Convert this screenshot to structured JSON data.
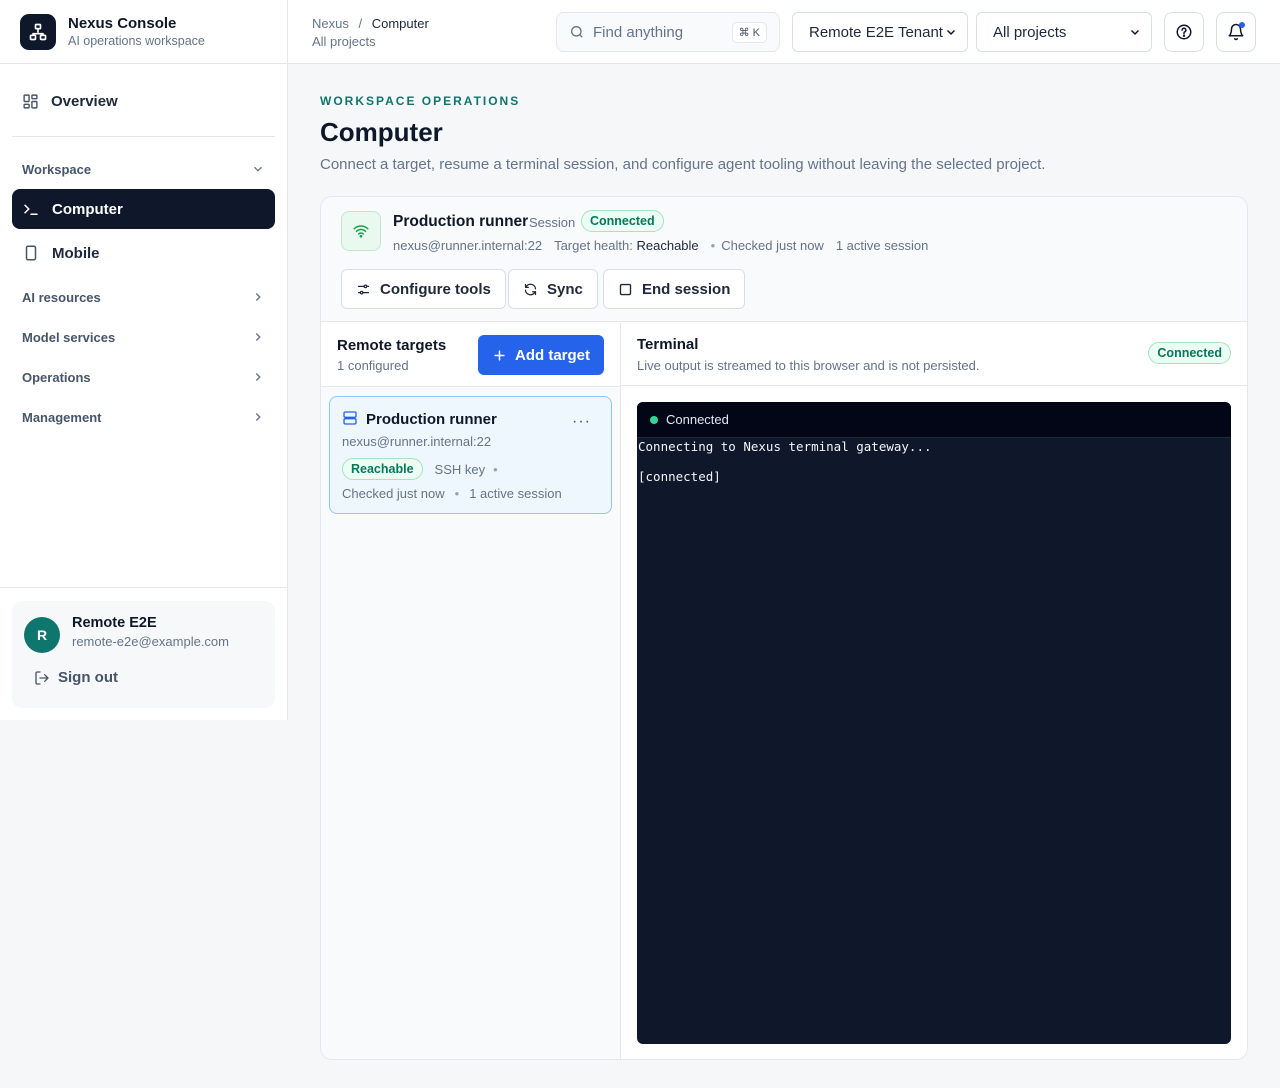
{
  "brand": {
    "title": "Nexus Console",
    "subtitle": "AI operations workspace"
  },
  "sidebar": {
    "overview": "Overview",
    "groups": {
      "workspace": "Workspace",
      "ai_resources": "AI resources",
      "model_services": "Model services",
      "operations": "Operations",
      "management": "Management"
    },
    "items": {
      "computer": "Computer",
      "mobile": "Mobile"
    }
  },
  "user": {
    "initial": "R",
    "name": "Remote E2E",
    "email": "remote-e2e@example.com",
    "signout": "Sign out"
  },
  "topbar": {
    "breadcrumb_root": "Nexus",
    "breadcrumb_sep": "/",
    "breadcrumb_current": "Computer",
    "breadcrumb_sub": "All projects",
    "search_placeholder": "Find anything",
    "search_shortcut": "⌘ K",
    "tenant": "Remote E2E Tenant",
    "project": "All projects"
  },
  "header": {
    "eyebrow": "WORKSPACE OPERATIONS",
    "title": "Computer",
    "description": "Connect a target, resume a terminal session, and configure agent tooling without leaving the selected project."
  },
  "session": {
    "name": "Production runner",
    "label": "Session",
    "status": "Connected",
    "host": "nexus@runner.internal:22",
    "health_label": "Target health:",
    "health_value": "Reachable",
    "dot": "•",
    "checked": "Checked just now",
    "active": "1 active session",
    "actions": {
      "configure": "Configure tools",
      "sync": "Sync",
      "end": "End session"
    }
  },
  "targets": {
    "title": "Remote targets",
    "count": "1 configured",
    "add": "Add target",
    "items": [
      {
        "name": "Production runner",
        "host": "nexus@runner.internal:22",
        "status": "Reachable",
        "auth": "SSH key",
        "dot": "•",
        "checked": "Checked just now",
        "active": "1 active session",
        "more": "···"
      }
    ]
  },
  "terminal": {
    "title": "Terminal",
    "subtitle": "Live output is streamed to this browser and is not persisted.",
    "status": "Connected",
    "bar_status": "Connected",
    "lines": [
      "Connecting to Nexus terminal gateway...",
      "",
      "[connected]"
    ]
  },
  "colors": {
    "accent": "#2563eb",
    "success": "#047857",
    "dark": "#0f172a",
    "teal": "#0f766e"
  },
  "icons": {
    "brand": "org-chart-icon",
    "overview": "grid-icon",
    "computer": "terminal-prompt-icon",
    "mobile": "smartphone-icon",
    "chevron": "chevron-icon",
    "signout": "sign-out-icon",
    "search": "search-icon",
    "help": "help-circle-icon",
    "bell": "bell-icon",
    "wifi": "wifi-icon",
    "sliders": "sliders-icon",
    "sync": "refresh-icon",
    "stop": "square-icon",
    "plus": "plus-icon",
    "server": "server-icon",
    "more": "more-horizontal-icon"
  }
}
